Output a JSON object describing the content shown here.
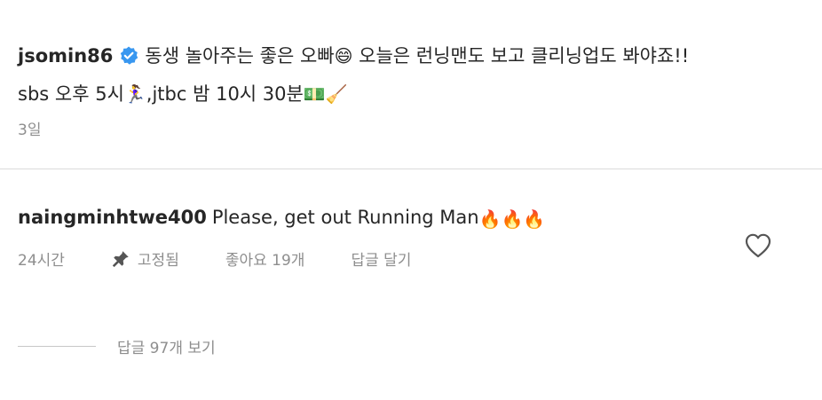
{
  "post": {
    "username": "jsomin86",
    "verified_icon": "verified-badge-icon",
    "caption_part1": "동생 놀아주는 좋은 오빠",
    "caption_emoji1": "😄",
    "caption_part2": " 오늘은 런닝맨도 보고 클리닝업도 봐야죠!!",
    "caption_line2_part1": "sbs 오후 5시",
    "caption_emoji2": "🏃‍♀️",
    "caption_line2_part2": ",jtbc 밤 10시 30분",
    "caption_emoji3": "💵🧹",
    "time": "3일"
  },
  "comment": {
    "author": "naingminhtwe400",
    "text": "Please, get out Running Man",
    "emoji": "🔥🔥🔥",
    "time": "24시간",
    "pinned_label": "고정됨",
    "likes_label": "좋아요 19개",
    "reply_label": "답글 달기"
  },
  "replies": {
    "view_label": "답글 97개 보기"
  },
  "colors": {
    "text": "#262626",
    "secondary": "#8e8e8e",
    "verified": "#3897f0",
    "divider": "#dbdbdb"
  }
}
